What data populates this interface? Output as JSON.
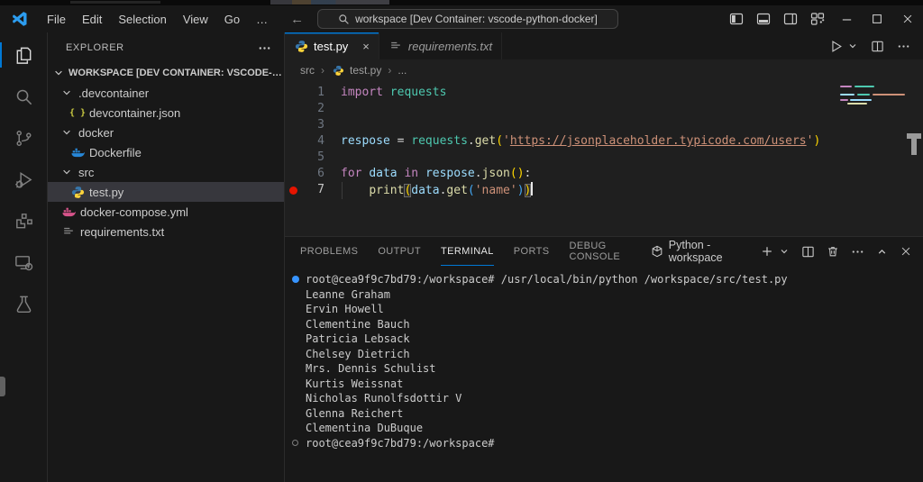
{
  "colors": {
    "accent": "#0078d4",
    "breakpoint": "#e51400",
    "terminal_deco_blue": "#3794ff",
    "python_icon_blue": "#3776ab",
    "python_icon_yellow": "#ffd43b",
    "dockerfile_icon": "#2787d8",
    "compose_icon": "#d6538a",
    "json_icon": "#cbcb41"
  },
  "title_bar": {
    "menus": [
      {
        "label": "File",
        "name": "menu-file"
      },
      {
        "label": "Edit",
        "name": "menu-edit"
      },
      {
        "label": "Selection",
        "name": "menu-selection"
      },
      {
        "label": "View",
        "name": "menu-view"
      },
      {
        "label": "Go",
        "name": "menu-go"
      },
      {
        "label": "…",
        "name": "menu-more"
      }
    ],
    "search_text": "workspace [Dev Container: vscode-python-docker]",
    "window_controls": [
      {
        "name": "toggle-primary-sidebar-icon",
        "icon": "layout-left",
        "kind": "layout"
      },
      {
        "name": "toggle-panel-icon",
        "icon": "layout-bottom",
        "kind": "layout"
      },
      {
        "name": "toggle-secondary-sidebar-icon",
        "icon": "layout-right",
        "kind": "layout"
      },
      {
        "name": "customize-layout-icon",
        "icon": "layout-grid",
        "kind": "layout"
      },
      {
        "name": "minimize-button",
        "icon": "min",
        "kind": "win"
      },
      {
        "name": "maximize-button",
        "icon": "max",
        "kind": "win"
      },
      {
        "name": "close-window-button",
        "icon": "close",
        "kind": "win"
      }
    ]
  },
  "activity_bar": {
    "items": [
      {
        "name": "explorer",
        "icon": "files",
        "active": true
      },
      {
        "name": "search",
        "icon": "search",
        "active": false
      },
      {
        "name": "source-control",
        "icon": "scm",
        "active": false
      },
      {
        "name": "run-and-debug",
        "icon": "debug",
        "active": false
      },
      {
        "name": "extensions",
        "icon": "extensions",
        "active": false
      },
      {
        "name": "remote-explorer",
        "icon": "remote",
        "active": false
      },
      {
        "name": "testing",
        "icon": "testing",
        "active": false
      }
    ]
  },
  "sidebar": {
    "title": "EXPLORER",
    "workspace_label": "WORKSPACE [DEV CONTAINER: VSCODE-PYT...",
    "tree": [
      {
        "label": ".devcontainer",
        "type": "folder",
        "level": 1,
        "expanded": true
      },
      {
        "label": "devcontainer.json",
        "type": "json",
        "level": 2
      },
      {
        "label": "docker",
        "type": "folder",
        "level": 1,
        "expanded": true
      },
      {
        "label": "Dockerfile",
        "type": "docker",
        "level": 2
      },
      {
        "label": "src",
        "type": "folder",
        "level": 1,
        "expanded": true
      },
      {
        "label": "test.py",
        "type": "python",
        "level": 2,
        "selected": true
      },
      {
        "label": "docker-compose.yml",
        "type": "compose",
        "level": 1
      },
      {
        "label": "requirements.txt",
        "type": "text",
        "level": 1
      }
    ]
  },
  "editor": {
    "tabs": [
      {
        "label": "test.py",
        "icon": "python",
        "active": true,
        "closable": true,
        "preview": false
      },
      {
        "label": "requirements.txt",
        "icon": "text",
        "active": false,
        "closable": false,
        "preview": true
      }
    ],
    "actions": [
      {
        "name": "run-python-file-button",
        "icon": "run"
      },
      {
        "name": "run-dropdown",
        "icon": "chev-down"
      },
      {
        "name": "split-editor-button",
        "icon": "split"
      },
      {
        "name": "editor-more-actions-button",
        "icon": "more"
      }
    ],
    "breadcrumb": [
      "src",
      "test.py",
      "..."
    ],
    "code_lines": [
      {
        "n": "1",
        "tokens": [
          [
            "kw",
            "import"
          ],
          [
            "pl",
            " "
          ],
          [
            "mod",
            "requests"
          ]
        ]
      },
      {
        "n": "2",
        "tokens": []
      },
      {
        "n": "3",
        "tokens": []
      },
      {
        "n": "4",
        "tokens": [
          [
            "var",
            "respose"
          ],
          [
            "pl",
            " = "
          ],
          [
            "mod",
            "requests"
          ],
          [
            "pl",
            "."
          ],
          [
            "fn",
            "get"
          ],
          [
            "b1",
            "("
          ],
          [
            "str",
            "'"
          ],
          [
            "strl",
            "https://jsonplaceholder.typicode.com/users"
          ],
          [
            "str",
            "'"
          ],
          [
            "b1",
            ")"
          ]
        ]
      },
      {
        "n": "5",
        "tokens": []
      },
      {
        "n": "6",
        "tokens": [
          [
            "kw",
            "for"
          ],
          [
            "pl",
            " "
          ],
          [
            "var",
            "data"
          ],
          [
            "pl",
            " "
          ],
          [
            "kw",
            "in"
          ],
          [
            "pl",
            " "
          ],
          [
            "var",
            "respose"
          ],
          [
            "pl",
            "."
          ],
          [
            "fn",
            "json"
          ],
          [
            "b1",
            "()"
          ],
          [
            "pl",
            ":"
          ]
        ]
      },
      {
        "n": "7",
        "breakpoint": true,
        "cursor": true,
        "tokens": [
          [
            "ws",
            "    "
          ],
          [
            "fn",
            "print"
          ],
          [
            "b1x",
            "("
          ],
          [
            "var",
            "data"
          ],
          [
            "pl",
            "."
          ],
          [
            "fn",
            "get"
          ],
          [
            "b2",
            "("
          ],
          [
            "str",
            "'name'"
          ],
          [
            "b2",
            ")"
          ],
          [
            "b1x",
            ")"
          ]
        ]
      }
    ]
  },
  "panel": {
    "tabs": [
      {
        "label": "PROBLEMS",
        "active": false
      },
      {
        "label": "OUTPUT",
        "active": false
      },
      {
        "label": "TERMINAL",
        "active": true
      },
      {
        "label": "PORTS",
        "active": false
      },
      {
        "label": "DEBUG CONSOLE",
        "active": false
      }
    ],
    "profile_label": "Python - workspace",
    "actions": [
      {
        "name": "new-terminal-button",
        "icon": "plus"
      },
      {
        "name": "terminal-profile-dropdown",
        "icon": "chev-down"
      },
      {
        "name": "split-terminal-button",
        "icon": "split"
      },
      {
        "name": "kill-terminal-button",
        "icon": "trash"
      },
      {
        "name": "panel-more-actions-button",
        "icon": "more"
      },
      {
        "name": "maximize-panel-button",
        "icon": "chev-up"
      },
      {
        "name": "close-panel-button",
        "icon": "close"
      }
    ],
    "terminal_lines": [
      {
        "deco": "filled",
        "text": "root@cea9f9c7bd79:/workspace# /usr/local/bin/python /workspace/src/test.py"
      },
      {
        "deco": null,
        "text": "Leanne Graham"
      },
      {
        "deco": null,
        "text": "Ervin Howell"
      },
      {
        "deco": null,
        "text": "Clementine Bauch"
      },
      {
        "deco": null,
        "text": "Patricia Lebsack"
      },
      {
        "deco": null,
        "text": "Chelsey Dietrich"
      },
      {
        "deco": null,
        "text": "Mrs. Dennis Schulist"
      },
      {
        "deco": null,
        "text": "Kurtis Weissnat"
      },
      {
        "deco": null,
        "text": "Nicholas Runolfsdottir V"
      },
      {
        "deco": null,
        "text": "Glenna Reichert"
      },
      {
        "deco": null,
        "text": "Clementina DuBuque"
      },
      {
        "deco": "open",
        "text": "root@cea9f9c7bd79:/workspace#"
      }
    ]
  }
}
